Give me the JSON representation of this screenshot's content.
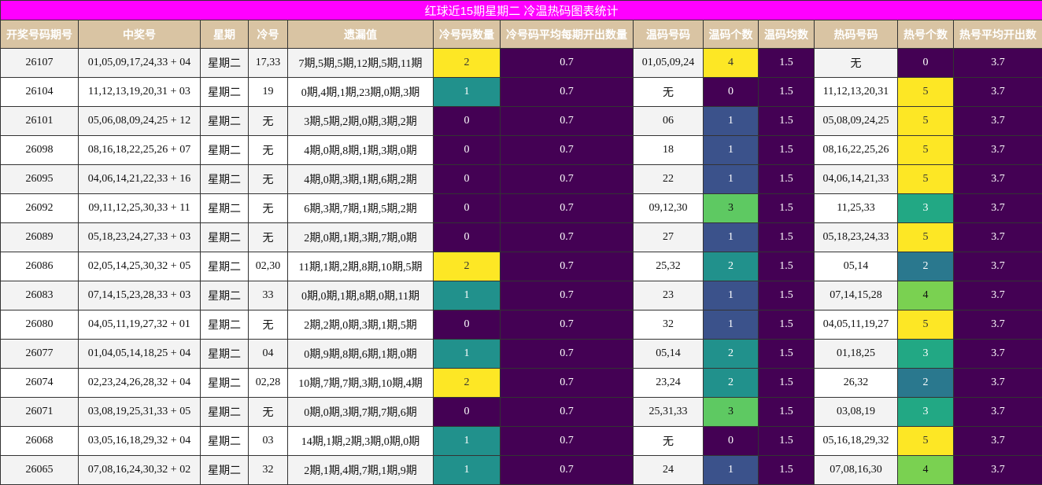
{
  "title": "红球近15期星期二 冷温热码图表统计",
  "headers": [
    "开奖号码期号",
    "中奖号",
    "星期",
    "冷号",
    "遗漏值",
    "冷号码数量",
    "冷号码平均每期开出数量",
    "温码号码",
    "温码个数",
    "温码均数",
    "热码号码",
    "热号个数",
    "热号平均开出数"
  ],
  "colors": {
    "title_bg": "#ff00ff",
    "header_bg": "#d9c4a3",
    "dark": "#440154",
    "yellow": "#fde725",
    "teal": "#21918c",
    "blue": "#3b528b",
    "green": "#5ec962",
    "lime": "#7ad151",
    "cyan": "#2a788e",
    "sea": "#22a884"
  },
  "rows": [
    {
      "issue": "26107",
      "numbers": "01,05,09,17,24,33 + 04",
      "weekday": "星期二",
      "cold": "17,33",
      "omission": "7期,5期,5期,12期,5期,11期",
      "cold_count": "2",
      "cold_count_color": "yellow",
      "cold_avg": "0.7",
      "warm": "01,05,09,24",
      "warm_count": "4",
      "warm_count_color": "yellow",
      "warm_avg": "1.5",
      "hot": "无",
      "hot_count": "0",
      "hot_count_color": "dark",
      "hot_avg": "3.7"
    },
    {
      "issue": "26104",
      "numbers": "11,12,13,19,20,31 + 03",
      "weekday": "星期二",
      "cold": "19",
      "omission": "0期,4期,1期,23期,0期,3期",
      "cold_count": "1",
      "cold_count_color": "teal",
      "cold_avg": "0.7",
      "warm": "无",
      "warm_count": "0",
      "warm_count_color": "dark",
      "warm_avg": "1.5",
      "hot": "11,12,13,20,31",
      "hot_count": "5",
      "hot_count_color": "yellow",
      "hot_avg": "3.7"
    },
    {
      "issue": "26101",
      "numbers": "05,06,08,09,24,25 + 12",
      "weekday": "星期二",
      "cold": "无",
      "omission": "3期,5期,2期,0期,3期,2期",
      "cold_count": "0",
      "cold_count_color": "dark",
      "cold_avg": "0.7",
      "warm": "06",
      "warm_count": "1",
      "warm_count_color": "blue",
      "warm_avg": "1.5",
      "hot": "05,08,09,24,25",
      "hot_count": "5",
      "hot_count_color": "yellow",
      "hot_avg": "3.7"
    },
    {
      "issue": "26098",
      "numbers": "08,16,18,22,25,26 + 07",
      "weekday": "星期二",
      "cold": "无",
      "omission": "4期,0期,8期,1期,3期,0期",
      "cold_count": "0",
      "cold_count_color": "dark",
      "cold_avg": "0.7",
      "warm": "18",
      "warm_count": "1",
      "warm_count_color": "blue",
      "warm_avg": "1.5",
      "hot": "08,16,22,25,26",
      "hot_count": "5",
      "hot_count_color": "yellow",
      "hot_avg": "3.7"
    },
    {
      "issue": "26095",
      "numbers": "04,06,14,21,22,33 + 16",
      "weekday": "星期二",
      "cold": "无",
      "omission": "4期,0期,3期,1期,6期,2期",
      "cold_count": "0",
      "cold_count_color": "dark",
      "cold_avg": "0.7",
      "warm": "22",
      "warm_count": "1",
      "warm_count_color": "blue",
      "warm_avg": "1.5",
      "hot": "04,06,14,21,33",
      "hot_count": "5",
      "hot_count_color": "yellow",
      "hot_avg": "3.7"
    },
    {
      "issue": "26092",
      "numbers": "09,11,12,25,30,33 + 11",
      "weekday": "星期二",
      "cold": "无",
      "omission": "6期,3期,7期,1期,5期,2期",
      "cold_count": "0",
      "cold_count_color": "dark",
      "cold_avg": "0.7",
      "warm": "09,12,30",
      "warm_count": "3",
      "warm_count_color": "green",
      "warm_avg": "1.5",
      "hot": "11,25,33",
      "hot_count": "3",
      "hot_count_color": "sea",
      "hot_avg": "3.7"
    },
    {
      "issue": "26089",
      "numbers": "05,18,23,24,27,33 + 03",
      "weekday": "星期二",
      "cold": "无",
      "omission": "2期,0期,1期,3期,7期,0期",
      "cold_count": "0",
      "cold_count_color": "dark",
      "cold_avg": "0.7",
      "warm": "27",
      "warm_count": "1",
      "warm_count_color": "blue",
      "warm_avg": "1.5",
      "hot": "05,18,23,24,33",
      "hot_count": "5",
      "hot_count_color": "yellow",
      "hot_avg": "3.7"
    },
    {
      "issue": "26086",
      "numbers": "02,05,14,25,30,32 + 05",
      "weekday": "星期二",
      "cold": "02,30",
      "omission": "11期,1期,2期,8期,10期,5期",
      "cold_count": "2",
      "cold_count_color": "yellow",
      "cold_avg": "0.7",
      "warm": "25,32",
      "warm_count": "2",
      "warm_count_color": "teal",
      "warm_avg": "1.5",
      "hot": "05,14",
      "hot_count": "2",
      "hot_count_color": "cyan",
      "hot_avg": "3.7"
    },
    {
      "issue": "26083",
      "numbers": "07,14,15,23,28,33 + 03",
      "weekday": "星期二",
      "cold": "33",
      "omission": "0期,0期,1期,8期,0期,11期",
      "cold_count": "1",
      "cold_count_color": "teal",
      "cold_avg": "0.7",
      "warm": "23",
      "warm_count": "1",
      "warm_count_color": "blue",
      "warm_avg": "1.5",
      "hot": "07,14,15,28",
      "hot_count": "4",
      "hot_count_color": "lime",
      "hot_avg": "3.7"
    },
    {
      "issue": "26080",
      "numbers": "04,05,11,19,27,32 + 01",
      "weekday": "星期二",
      "cold": "无",
      "omission": "2期,2期,0期,3期,1期,5期",
      "cold_count": "0",
      "cold_count_color": "dark",
      "cold_avg": "0.7",
      "warm": "32",
      "warm_count": "1",
      "warm_count_color": "blue",
      "warm_avg": "1.5",
      "hot": "04,05,11,19,27",
      "hot_count": "5",
      "hot_count_color": "yellow",
      "hot_avg": "3.7"
    },
    {
      "issue": "26077",
      "numbers": "01,04,05,14,18,25 + 04",
      "weekday": "星期二",
      "cold": "04",
      "omission": "0期,9期,8期,6期,1期,0期",
      "cold_count": "1",
      "cold_count_color": "teal",
      "cold_avg": "0.7",
      "warm": "05,14",
      "warm_count": "2",
      "warm_count_color": "teal",
      "warm_avg": "1.5",
      "hot": "01,18,25",
      "hot_count": "3",
      "hot_count_color": "sea",
      "hot_avg": "3.7"
    },
    {
      "issue": "26074",
      "numbers": "02,23,24,26,28,32 + 04",
      "weekday": "星期二",
      "cold": "02,28",
      "omission": "10期,7期,7期,3期,10期,4期",
      "cold_count": "2",
      "cold_count_color": "yellow",
      "cold_avg": "0.7",
      "warm": "23,24",
      "warm_count": "2",
      "warm_count_color": "teal",
      "warm_avg": "1.5",
      "hot": "26,32",
      "hot_count": "2",
      "hot_count_color": "cyan",
      "hot_avg": "3.7"
    },
    {
      "issue": "26071",
      "numbers": "03,08,19,25,31,33 + 05",
      "weekday": "星期二",
      "cold": "无",
      "omission": "0期,0期,3期,7期,7期,6期",
      "cold_count": "0",
      "cold_count_color": "dark",
      "cold_avg": "0.7",
      "warm": "25,31,33",
      "warm_count": "3",
      "warm_count_color": "green",
      "warm_avg": "1.5",
      "hot": "03,08,19",
      "hot_count": "3",
      "hot_count_color": "sea",
      "hot_avg": "3.7"
    },
    {
      "issue": "26068",
      "numbers": "03,05,16,18,29,32 + 04",
      "weekday": "星期二",
      "cold": "03",
      "omission": "14期,1期,2期,3期,0期,0期",
      "cold_count": "1",
      "cold_count_color": "teal",
      "cold_avg": "0.7",
      "warm": "无",
      "warm_count": "0",
      "warm_count_color": "dark",
      "warm_avg": "1.5",
      "hot": "05,16,18,29,32",
      "hot_count": "5",
      "hot_count_color": "yellow",
      "hot_avg": "3.7"
    },
    {
      "issue": "26065",
      "numbers": "07,08,16,24,30,32 + 02",
      "weekday": "星期二",
      "cold": "32",
      "omission": "2期,1期,4期,7期,1期,9期",
      "cold_count": "1",
      "cold_count_color": "teal",
      "cold_avg": "0.7",
      "warm": "24",
      "warm_count": "1",
      "warm_count_color": "blue",
      "warm_avg": "1.5",
      "hot": "07,08,16,30",
      "hot_count": "4",
      "hot_count_color": "lime",
      "hot_avg": "3.7"
    }
  ]
}
